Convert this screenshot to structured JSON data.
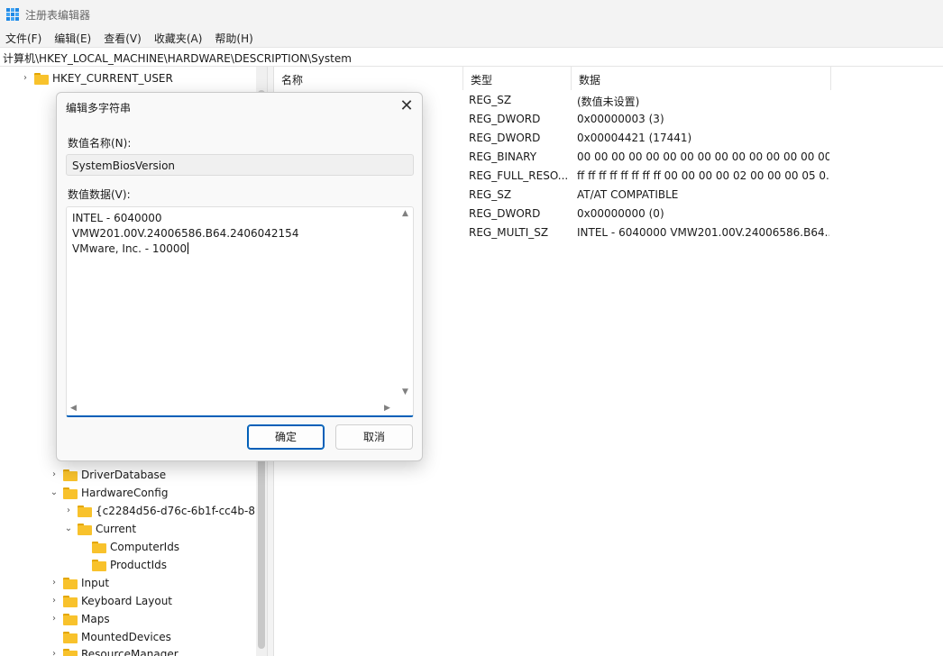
{
  "window": {
    "title": "注册表编辑器"
  },
  "menu": [
    "文件(F)",
    "编辑(E)",
    "查看(V)",
    "收藏夹(A)",
    "帮助(H)"
  ],
  "address": "计算机\\HKEY_LOCAL_MACHINE\\HARDWARE\\DESCRIPTION\\System",
  "tree": [
    {
      "label": "HKEY_CURRENT_USER",
      "chevron": "›"
    },
    {
      "label": "DriverDatabase",
      "chevron": "›"
    },
    {
      "label": "HardwareConfig",
      "chevron": "⌄"
    },
    {
      "label": "{c2284d56-d76c-6b1f-cc4b-87",
      "chevron": "›"
    },
    {
      "label": "Current",
      "chevron": "⌄"
    },
    {
      "label": "ComputerIds",
      "chevron": ""
    },
    {
      "label": "ProductIds",
      "chevron": ""
    },
    {
      "label": "Input",
      "chevron": "›"
    },
    {
      "label": "Keyboard Layout",
      "chevron": "›"
    },
    {
      "label": "Maps",
      "chevron": "›"
    },
    {
      "label": "MountedDevices",
      "chevron": ""
    },
    {
      "label": "ResourceManager",
      "chevron": "›"
    }
  ],
  "columns": {
    "name": "名称",
    "type": "类型",
    "data": "数据"
  },
  "rows": [
    {
      "type": "REG_SZ",
      "data": "(数值未设置)"
    },
    {
      "type": "REG_DWORD",
      "data": "0x00000003 (3)"
    },
    {
      "type": "REG_DWORD",
      "data": "0x00004421 (17441)"
    },
    {
      "type": "REG_BINARY",
      "data": "00 00 00 00 00 00 00 00 00 00 00 00 00 00 00 00..."
    },
    {
      "type": "REG_FULL_RESO...",
      "data": "ff ff ff ff ff ff ff ff 00 00 00 00 02 00 00 00 05 0..."
    },
    {
      "type": "REG_SZ",
      "data": "AT/AT COMPATIBLE"
    },
    {
      "type": "REG_DWORD",
      "data": "0x00000000 (0)"
    },
    {
      "type": "REG_MULTI_SZ",
      "data": "INTEL  - 6040000 VMW201.00V.24006586.B64..."
    }
  ],
  "dialog": {
    "title": "编辑多字符串",
    "close": "✕",
    "name_label": "数值名称(N):",
    "name_value": "SystemBiosVersion",
    "data_label": "数值数据(V):",
    "data_lines": [
      "INTEL  - 6040000",
      "VMW201.00V.24006586.B64.2406042154",
      "VMware, Inc. - 10000"
    ],
    "ok": "确定",
    "cancel": "取消"
  },
  "colors": {
    "accent": "#005fb8",
    "folder": "#f8c22c"
  },
  "icons": [
    "registry-app-icon",
    "folder-icon",
    "chevron-right-icon",
    "chevron-down-icon",
    "close-icon",
    "scroll-up-icon",
    "scroll-down-icon",
    "scroll-left-icon",
    "scroll-right-icon"
  ]
}
